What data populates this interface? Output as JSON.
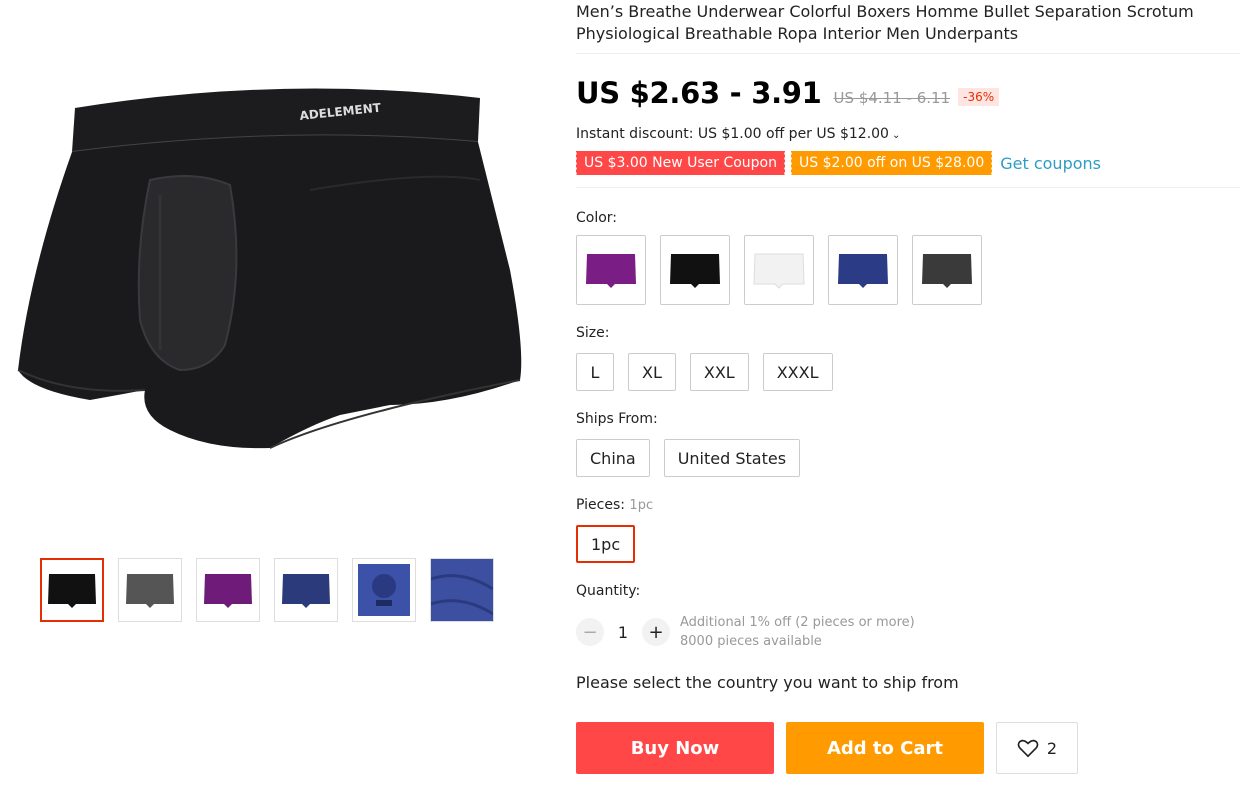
{
  "product": {
    "title": "Men’s Breathe Underwear Colorful Boxers Homme Bullet Separation Scrotum Physiological Breathable Ropa Interior Men Underpants",
    "price": "US $2.63 - 3.91",
    "original_price": "US $4.11 - 6.11",
    "discount": "-36%",
    "instant_discount": "Instant discount: US $1.00 off per US $12.00",
    "coupons": [
      "US $3.00 New User Coupon",
      "US $2.00 off on US $28.00"
    ],
    "get_coupons": "Get coupons",
    "brand_mark": "ADELEMENT"
  },
  "gallery": {
    "thumbnails": [
      "black",
      "gray",
      "purple",
      "navy",
      "blue-detail",
      "fabric"
    ],
    "active_index": 0
  },
  "color": {
    "label": "Color:",
    "options": [
      "purple",
      "black",
      "white",
      "navy",
      "gray"
    ]
  },
  "size": {
    "label": "Size:",
    "options": [
      "L",
      "XL",
      "XXL",
      "XXXL"
    ]
  },
  "ships_from": {
    "label": "Ships From:",
    "options": [
      "China",
      "United States"
    ]
  },
  "pieces": {
    "label": "Pieces:",
    "selected_hint": "1pc",
    "options": [
      "1pc"
    ]
  },
  "quantity": {
    "label": "Quantity:",
    "value": "1",
    "minus": "−",
    "plus": "+",
    "note1": "Additional 1% off (2 pieces or more)",
    "note2": "8000 pieces available"
  },
  "ship_note": "Please select the country you want to ship from",
  "actions": {
    "buy_now": "Buy Now",
    "add_to_cart": "Add to Cart",
    "wishlist_count": "2"
  },
  "colors": {
    "accent": "#ff4747",
    "orange": "#ff9b00",
    "link": "#2e9cc3",
    "selected_border": "#e62e04"
  }
}
